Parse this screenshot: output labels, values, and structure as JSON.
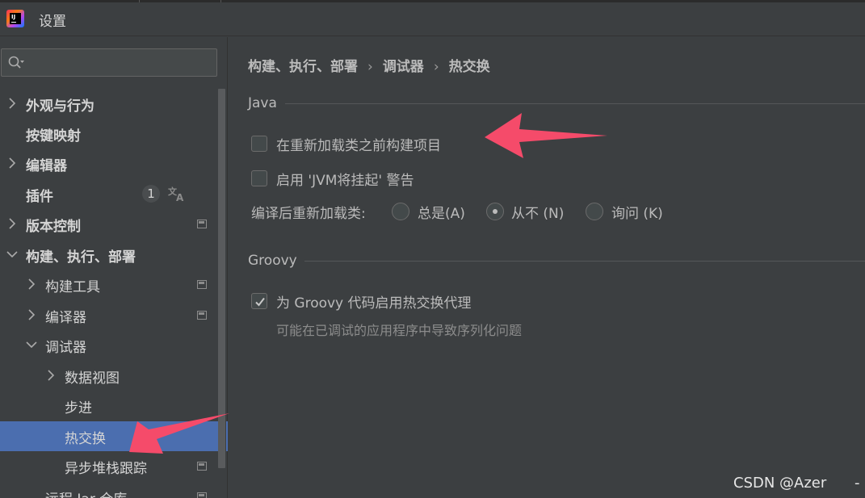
{
  "window": {
    "title": "设置"
  },
  "sidebar": {
    "search": {
      "placeholder": ""
    },
    "items": [
      {
        "label": "外观与行为",
        "expandable": true,
        "expanded": false,
        "bold": true
      },
      {
        "label": "按键映射",
        "expandable": false,
        "bold": true
      },
      {
        "label": "编辑器",
        "expandable": true,
        "expanded": false,
        "bold": true
      },
      {
        "label": "插件",
        "expandable": false,
        "bold": true,
        "badge": "1"
      },
      {
        "label": "版本控制",
        "expandable": true,
        "expanded": false,
        "bold": true
      },
      {
        "label": "构建、执行、部署",
        "expandable": true,
        "expanded": true,
        "bold": true
      },
      {
        "label": "构建工具",
        "expandable": true,
        "expanded": false,
        "bold": false
      },
      {
        "label": "编译器",
        "expandable": true,
        "expanded": false,
        "bold": false
      },
      {
        "label": "调试器",
        "expandable": true,
        "expanded": true,
        "bold": false
      },
      {
        "label": "数据视图",
        "expandable": true,
        "expanded": false,
        "bold": false
      },
      {
        "label": "步进",
        "expandable": false,
        "bold": false
      },
      {
        "label": "热交换",
        "expandable": false,
        "bold": false,
        "selected": true
      },
      {
        "label": "异步堆栈跟踪",
        "expandable": false,
        "bold": false
      },
      {
        "label": "远程 Jar 仓库",
        "expandable": false,
        "bold": false
      }
    ]
  },
  "main": {
    "breadcrumb": [
      "构建、执行、部署",
      "调试器",
      "热交换"
    ],
    "java_group": {
      "title": "Java",
      "build_before_reload": {
        "label": "在重新加载类之前构建项目",
        "checked": false
      },
      "jvm_hangs_warning": {
        "label": "启用 'JVM将挂起' 警告",
        "checked": false
      },
      "reload_after_compile": {
        "label": "编译后重新加载类:",
        "options": [
          "总是(A)",
          "从不 (N)",
          "询问 (K)"
        ],
        "selected": "从不 (N)"
      }
    },
    "groovy_group": {
      "title": "Groovy",
      "hotswap_agent": {
        "label": "为 Groovy 代码启用热交换代理",
        "checked": true
      },
      "hint": "可能在已调试的应用程序中导致序列化问题"
    }
  },
  "watermark": "CSDN @Azer",
  "trailing": "-",
  "colors": {
    "background": "#3c3f41",
    "selection": "#4b6eaf",
    "arrow": "#f54b6a"
  }
}
